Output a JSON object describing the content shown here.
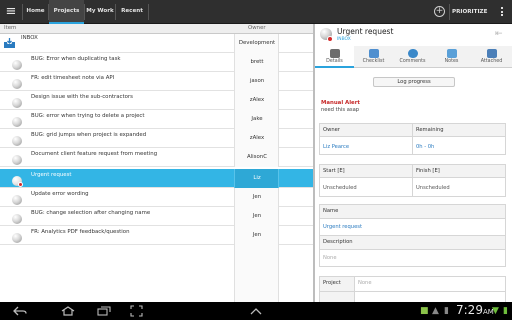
{
  "topbar": {
    "app_icon": "menu-lines-icon",
    "tabs": [
      {
        "label": "Home",
        "active": false
      },
      {
        "label": "Projects",
        "active": true
      },
      {
        "label": "My Work",
        "active": false
      },
      {
        "label": "Recent",
        "active": false
      }
    ],
    "add_icon": "+",
    "prioritize_label": "PRIORITIZE",
    "accent_color": "#2aa3dd"
  },
  "list": {
    "columns": {
      "item": "Item",
      "owner": "Owner"
    },
    "inbox": {
      "title": "INBOX",
      "owner": "Development"
    },
    "rows": [
      {
        "title": "BUG: Error when duplicating task",
        "owner": "brett",
        "selected": false
      },
      {
        "title": "FR: edit timesheet note via API",
        "owner": "jason",
        "selected": false
      },
      {
        "title": "Design issue with the sub-contractors",
        "owner": "zAlex",
        "selected": false
      },
      {
        "title": "BUG: error when trying to delete a project",
        "owner": "Jake",
        "selected": false
      },
      {
        "title": "BUG: grid jumps when project is expanded",
        "owner": "zAlex",
        "selected": false
      },
      {
        "title": "Document client feature request from meeting",
        "owner": "AlisonC",
        "selected": false
      },
      {
        "title": "Urgent request",
        "owner": "Liz",
        "selected": true
      },
      {
        "title": "Update error wording",
        "owner": "Jen",
        "selected": false
      },
      {
        "title": "BUG: change selection after changing name",
        "owner": "Jen",
        "selected": false
      },
      {
        "title": "FR: Analytics PDF feedback/question",
        "owner": "Jen",
        "selected": false
      }
    ],
    "selected_color": "#33b5e5"
  },
  "detail": {
    "title": "Urgent request",
    "subtitle": "INBOX",
    "tabs": [
      {
        "label": "Details",
        "icon": "details-icon",
        "active": true
      },
      {
        "label": "Checklist",
        "icon": "checklist-icon",
        "active": false
      },
      {
        "label": "Comments",
        "icon": "comments-icon",
        "active": false
      },
      {
        "label": "Notes",
        "icon": "notes-icon",
        "active": false
      },
      {
        "label": "Attached",
        "icon": "attached-icon",
        "active": false
      }
    ],
    "log_progress": "Log progress",
    "manual_alert_label": "Manual Alert",
    "manual_alert_text": "need this asap",
    "owner_label": "Owner",
    "owner_value": "Liz Pearce",
    "remaining_label": "Remaining",
    "remaining_value": "0h - 0h",
    "start_label": "Start [E]",
    "start_value": "Unscheduled",
    "finish_label": "Finish [E]",
    "finish_value": "Unscheduled",
    "name_label": "Name",
    "name_value": "Urgent request",
    "description_label": "Description",
    "description_value": "None",
    "project_label": "Project",
    "project_value": "None"
  },
  "system": {
    "time": "7:29",
    "ampm": "AM",
    "back_icon": "back-icon",
    "home_icon": "home-icon",
    "recent_icon": "recent-apps-icon",
    "screenshot_icon": "screenshot-icon",
    "up_icon": "chevron-up-icon"
  }
}
